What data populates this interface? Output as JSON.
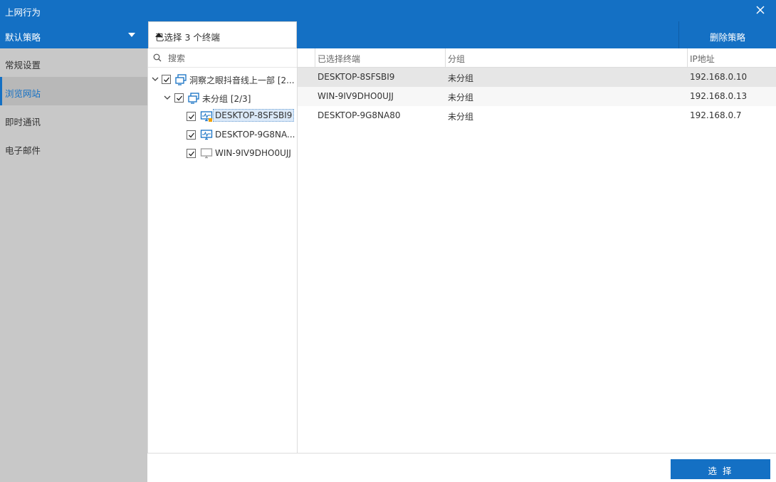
{
  "window": {
    "title": "上网行为"
  },
  "header": {
    "policy_label": "默认策略",
    "terminal_dropdown_label": "已选择 3 个终端",
    "delete_policy_label": "删除策略"
  },
  "sidebar": {
    "items": [
      {
        "label": "常规设置",
        "active": false
      },
      {
        "label": "浏览网站",
        "active": true
      },
      {
        "label": "即时通讯",
        "active": false
      },
      {
        "label": "电子邮件",
        "active": false
      }
    ]
  },
  "search": {
    "placeholder": "搜索",
    "value": ""
  },
  "tree": {
    "root": {
      "label": "洞察之眼抖音线上一部 [2...",
      "checked": true,
      "expanded": true,
      "icon": "group-icon"
    },
    "group": {
      "label": "未分组 [2/3]",
      "checked": true,
      "expanded": true,
      "icon": "group-icon"
    },
    "terminals": [
      {
        "label": "DESKTOP-8SFSBI9",
        "checked": true,
        "selected": true,
        "icon": "computer-online-icon"
      },
      {
        "label": "DESKTOP-9G8NA...",
        "checked": true,
        "selected": false,
        "icon": "computer-online-icon"
      },
      {
        "label": "WIN-9IV9DHO0UJJ",
        "checked": true,
        "selected": false,
        "icon": "computer-offline-icon"
      }
    ]
  },
  "table": {
    "columns": [
      "已选择终端",
      "分组",
      "IP地址"
    ],
    "rows": [
      {
        "terminal": "DESKTOP-8SFSBI9",
        "group": "未分组",
        "ip": "192.168.0.10"
      },
      {
        "terminal": "WIN-9IV9DHO0UJJ",
        "group": "未分组",
        "ip": "192.168.0.13"
      },
      {
        "terminal": "DESKTOP-9G8NA80",
        "group": "未分组",
        "ip": "192.168.0.7"
      }
    ]
  },
  "footer": {
    "select_label": "选 择"
  },
  "colors": {
    "accent": "#1470c4",
    "sidebar_bg": "#c8c8c8",
    "sidebar_active_bg": "#b8b8b8"
  }
}
